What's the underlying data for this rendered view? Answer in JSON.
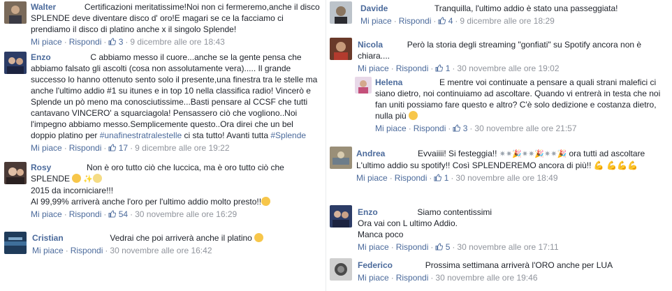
{
  "left": [
    {
      "name": "Walter",
      "text": "Certificazioni meritatissime!Noi non ci fermeremo,anche il disco SPLENDE deve diventare disco d' oro!E magari se ce la facciamo ci prendiamo il disco di platino anche x il singolo Splende!",
      "like": "Mi piace",
      "reply": "Rispondi",
      "likes": "3",
      "time": "9 dicembre alle ore 18:43"
    },
    {
      "name": "Enzo",
      "text_a": "C abbiamo messo il cuore...anche se la gente pensa che abbiamo falsato gli ascolti (cosa non assolutamente vera)..... Il grande successo lo hanno ottenuto sento solo il presente,una finestra tra le stelle ma anche l'ultimo addio #1 su itunes e in top 10 nella classifica radio! Vincerò e Splende un pò meno ma conosciutissime...Basti pensare al CCSF che tutti cantavano VINCERO' a squarciagola! Pensassero ciò che vogliono..Noi l'impegno abbiamo messo.Semplicemente questo..Ora direi che un bel doppio platino per ",
      "hashtag1": "#unafinestratralestelle",
      "text_b": " ci sta tutto! Avanti tutta ",
      "hashtag2": "#Splende",
      "like": "Mi piace",
      "reply": "Rispondi",
      "likes": "17",
      "time": "9 dicembre alle ore 19:22"
    },
    {
      "name": "Rosy",
      "text_a": "Non è oro tutto ciò che luccica, ma è oro tutto ciò che SPLENDE ",
      "line2": "2015 da incorniciare!!!",
      "line3": "Al 99,99% arriverà anche l'oro per l'ultimo addio molto presto!!",
      "like": "Mi piace",
      "reply": "Rispondi",
      "likes": "54",
      "time": "30 novembre alle ore 16:29"
    },
    {
      "name": "Cristian",
      "text": "Vedrai che poi arriverà anche il platino",
      "like": "Mi piace",
      "reply": "Rispondi",
      "time": "30 novembre alle ore 16:42"
    }
  ],
  "right": [
    {
      "name": "Davide",
      "text": "Tranquilla, l'ultimo addio è stato una passeggiata!",
      "like": "Mi piace",
      "reply": "Rispondi",
      "likes": "4",
      "time": "9 dicembre alle ore 18:29"
    },
    {
      "name": "Nicola",
      "text": "Però la storia degli streaming \"gonfiati\" su Spotify ancora non è chiara....",
      "like": "Mi piace",
      "reply": "Rispondi",
      "likes": "1",
      "time": "30 novembre alle ore 19:02"
    },
    {
      "name": "Helena",
      "text": "E mentre voi continuate a pensare a quali strani malefici ci siano dietro, noi continuiamo ad ascoltare. Quando vi entrerà in testa che noi fan uniti possiamo fare questo e altro? C'è solo dedizione e costanza dietro, nulla più ",
      "like": "Mi piace",
      "reply": "Rispondi",
      "likes": "3",
      "time": "30 novembre alle ore 21:57"
    },
    {
      "name": "Andrea",
      "text_a": "Evvaiiii! Si festeggia!! ",
      "text_b": " ora tutti ad ascoltare L'ultimo addio su spotify!! Così SPLENDEREMO ancora di più!! ",
      "like": "Mi piace",
      "reply": "Rispondi",
      "likes": "1",
      "time": "30 novembre alle ore 18:49"
    },
    {
      "name": "Enzo",
      "line1": "Siamo contentissimi",
      "line2": "Ora vai con L ultimo Addio.",
      "line3": "Manca poco",
      "like": "Mi piace",
      "reply": "Rispondi",
      "likes": "5",
      "time": "30 novembre alle ore 17:11"
    },
    {
      "name": "Federico",
      "text": "Prossima settimana arriverà l'ORO anche per LUA",
      "like": "Mi piace",
      "reply": "Rispondi",
      "time": "30 novembre alle ore 19:46"
    }
  ],
  "colors": {
    "link": "#4b6a9b",
    "meta": "#90949c",
    "text": "#1d2129"
  },
  "icons": [
    "thumbs-up-icon",
    "emoji-icon",
    "sparkle-icon",
    "party-popper-icon",
    "muscle-icon"
  ]
}
